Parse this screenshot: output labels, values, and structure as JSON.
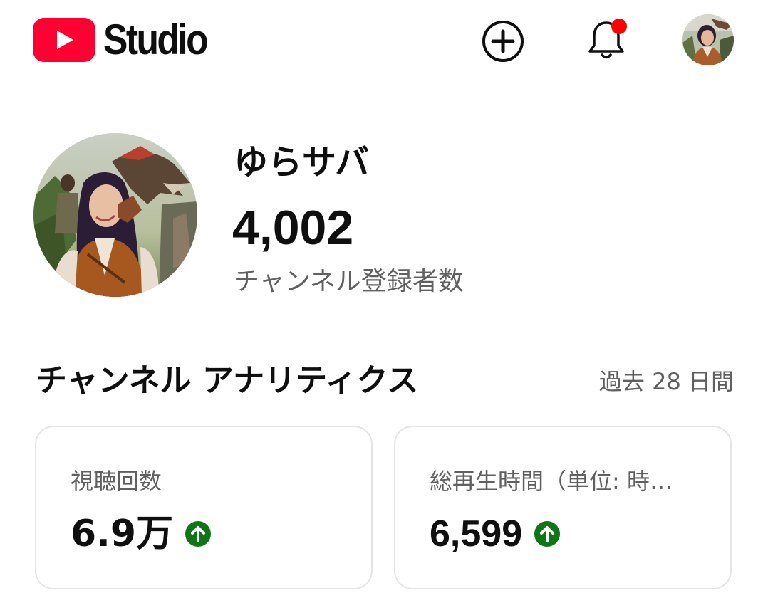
{
  "app": {
    "logo_text": "Studio",
    "brand_color": "#ff0033",
    "notification_dot_color": "#ff0000"
  },
  "header": {
    "icons": [
      "youtube-play-icon",
      "create-plus-icon",
      "bell-icon",
      "account-avatar"
    ]
  },
  "channel": {
    "name": "ゆらサバ",
    "subscriber_count": "4,002",
    "subscriber_label": "チャンネル登録者数"
  },
  "analytics": {
    "title": "チャンネル アナリティクス",
    "period": "過去 28 日間",
    "trend_color": "#107516",
    "cards": [
      {
        "label": "視聴回数",
        "value": "6.9万",
        "trend": "up"
      },
      {
        "label": "総再生時間（単位: 時…",
        "value": "6,599",
        "trend": "up"
      }
    ]
  }
}
